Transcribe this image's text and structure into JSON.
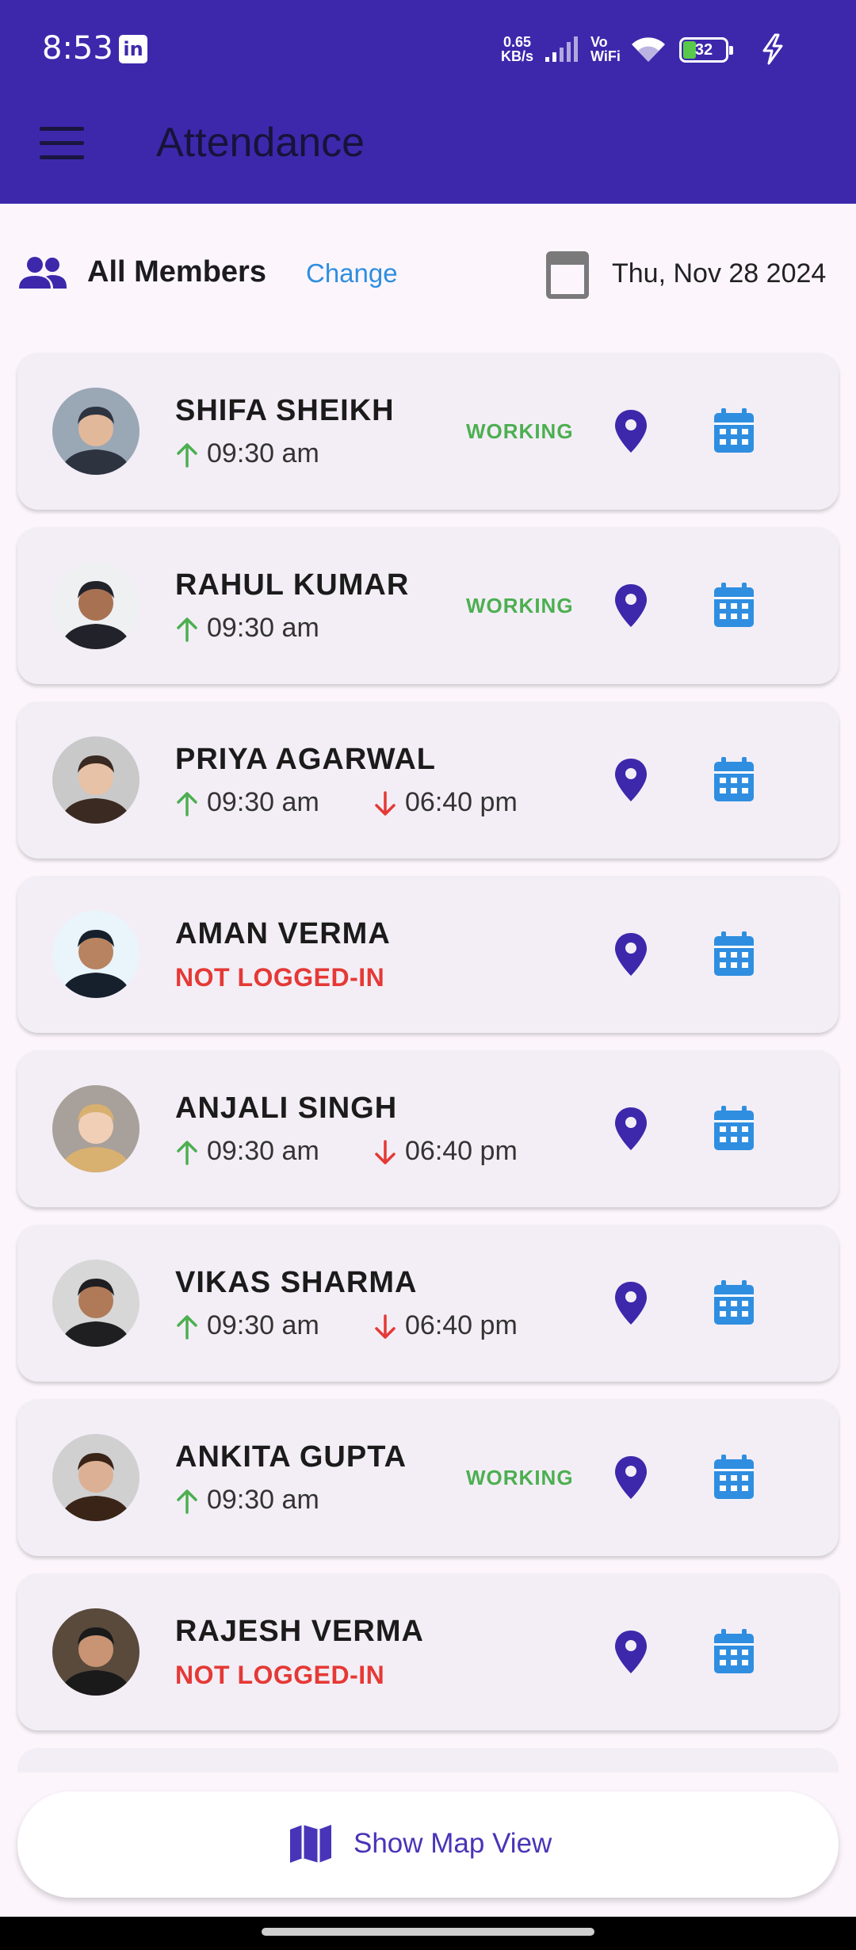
{
  "status_bar": {
    "time": "8:53",
    "linkedin_label": "in",
    "network_speed_value": "0.65",
    "network_speed_unit": "KB/s",
    "vo": "Vo",
    "wifi_label": "WiFi",
    "battery": "32"
  },
  "app_bar": {
    "title": "Attendance"
  },
  "filter": {
    "members_label": "All Members",
    "change_label": "Change",
    "date": "Thu, Nov 28 2024"
  },
  "members": [
    {
      "name": "SHIFA SHEIKH",
      "in": "09:30 am",
      "out": "",
      "status": "WORKING",
      "not_logged": ""
    },
    {
      "name": "RAHUL KUMAR",
      "in": "09:30 am",
      "out": "",
      "status": "WORKING",
      "not_logged": ""
    },
    {
      "name": "PRIYA AGARWAL",
      "in": "09:30 am",
      "out": "06:40 pm",
      "status": "",
      "not_logged": ""
    },
    {
      "name": "AMAN VERMA",
      "in": "",
      "out": "",
      "status": "",
      "not_logged": "NOT LOGGED-IN"
    },
    {
      "name": "ANJALI SINGH",
      "in": "09:30 am",
      "out": "06:40 pm",
      "status": "",
      "not_logged": ""
    },
    {
      "name": "VIKAS SHARMA",
      "in": "09:30 am",
      "out": "06:40 pm",
      "status": "",
      "not_logged": ""
    },
    {
      "name": "ANKITA GUPTA",
      "in": "09:30 am",
      "out": "",
      "status": "WORKING",
      "not_logged": ""
    },
    {
      "name": "RAJESH VERMA",
      "in": "",
      "out": "",
      "status": "",
      "not_logged": "NOT LOGGED-IN"
    }
  ],
  "map_button": {
    "label": "Show Map View"
  },
  "colors": {
    "primary": "#3d28ac",
    "accent_blue": "#2f8ee0",
    "working_green": "#4caf50",
    "not_logged_red": "#e53935",
    "check_out_red": "#e53935"
  },
  "icons": {
    "members": "group-icon",
    "date": "calendar-icon",
    "location": "location-pin-icon",
    "attendance_calendar": "calendar-icon",
    "map": "map-icon",
    "check_in": "arrow-up-icon",
    "check_out": "arrow-down-icon"
  }
}
